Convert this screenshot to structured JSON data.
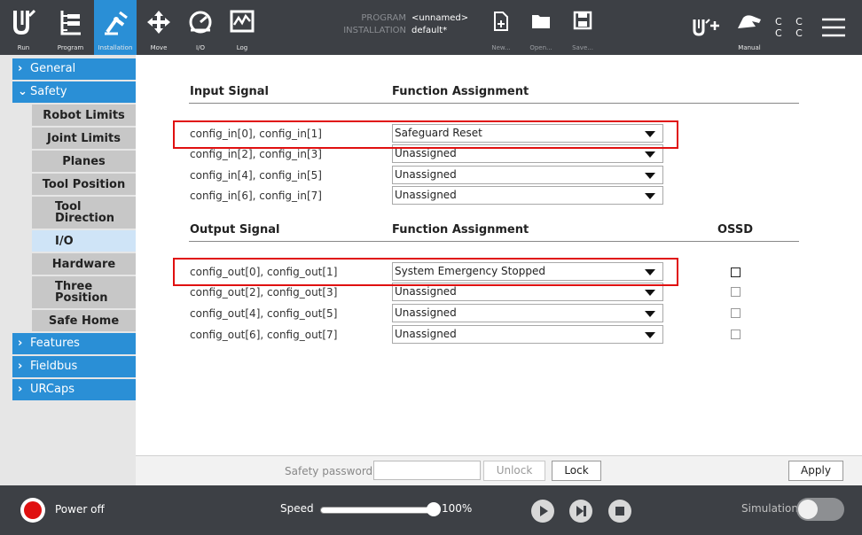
{
  "topbar": {
    "run": "Run",
    "program": "Program",
    "installation": "Installation",
    "move": "Move",
    "io": "I/O",
    "log": "Log",
    "program_key": "PROGRAM",
    "program_value": "<unnamed>",
    "installation_key": "INSTALLATION",
    "installation_value": "default*",
    "new": "New...",
    "open": "Open...",
    "save": "Save...",
    "manual": "Manual",
    "cc_row1": "C C",
    "cc_row2": "C C"
  },
  "sidebar": {
    "general": "General",
    "safety": "Safety",
    "robot_limits": "Robot Limits",
    "joint_limits": "Joint Limits",
    "planes": "Planes",
    "tool_position": "Tool Position",
    "tool_direction": "Tool Direction",
    "io": "I/O",
    "hardware": "Hardware",
    "three_position": "Three Position",
    "safe_home": "Safe Home",
    "features": "Features",
    "fieldbus": "Fieldbus",
    "urcaps": "URCaps"
  },
  "inputs": {
    "col_signal": "Input Signal",
    "col_function": "Function Assignment",
    "rows": [
      {
        "signal": "config_in[0], config_in[1]",
        "function": "Safeguard Reset"
      },
      {
        "signal": "config_in[2], config_in[3]",
        "function": "Unassigned"
      },
      {
        "signal": "config_in[4], config_in[5]",
        "function": "Unassigned"
      },
      {
        "signal": "config_in[6], config_in[7]",
        "function": "Unassigned"
      }
    ]
  },
  "outputs": {
    "col_signal": "Output Signal",
    "col_function": "Function Assignment",
    "col_ossd": "OSSD",
    "rows": [
      {
        "signal": "config_out[0], config_out[1]",
        "function": "System Emergency Stopped"
      },
      {
        "signal": "config_out[2], config_out[3]",
        "function": "Unassigned"
      },
      {
        "signal": "config_out[4], config_out[5]",
        "function": "Unassigned"
      },
      {
        "signal": "config_out[6], config_out[7]",
        "function": "Unassigned"
      }
    ]
  },
  "password": {
    "placeholder": "Safety password",
    "unlock": "Unlock",
    "lock": "Lock",
    "apply": "Apply"
  },
  "footer": {
    "power": "Power off",
    "speed_label": "Speed",
    "speed_value": "100%",
    "speed_fraction": 1.0,
    "simulation": "Simulation"
  },
  "colors": {
    "accent": "#2a8fd6",
    "topbar": "#3d4045",
    "highlight": "#e01010"
  }
}
